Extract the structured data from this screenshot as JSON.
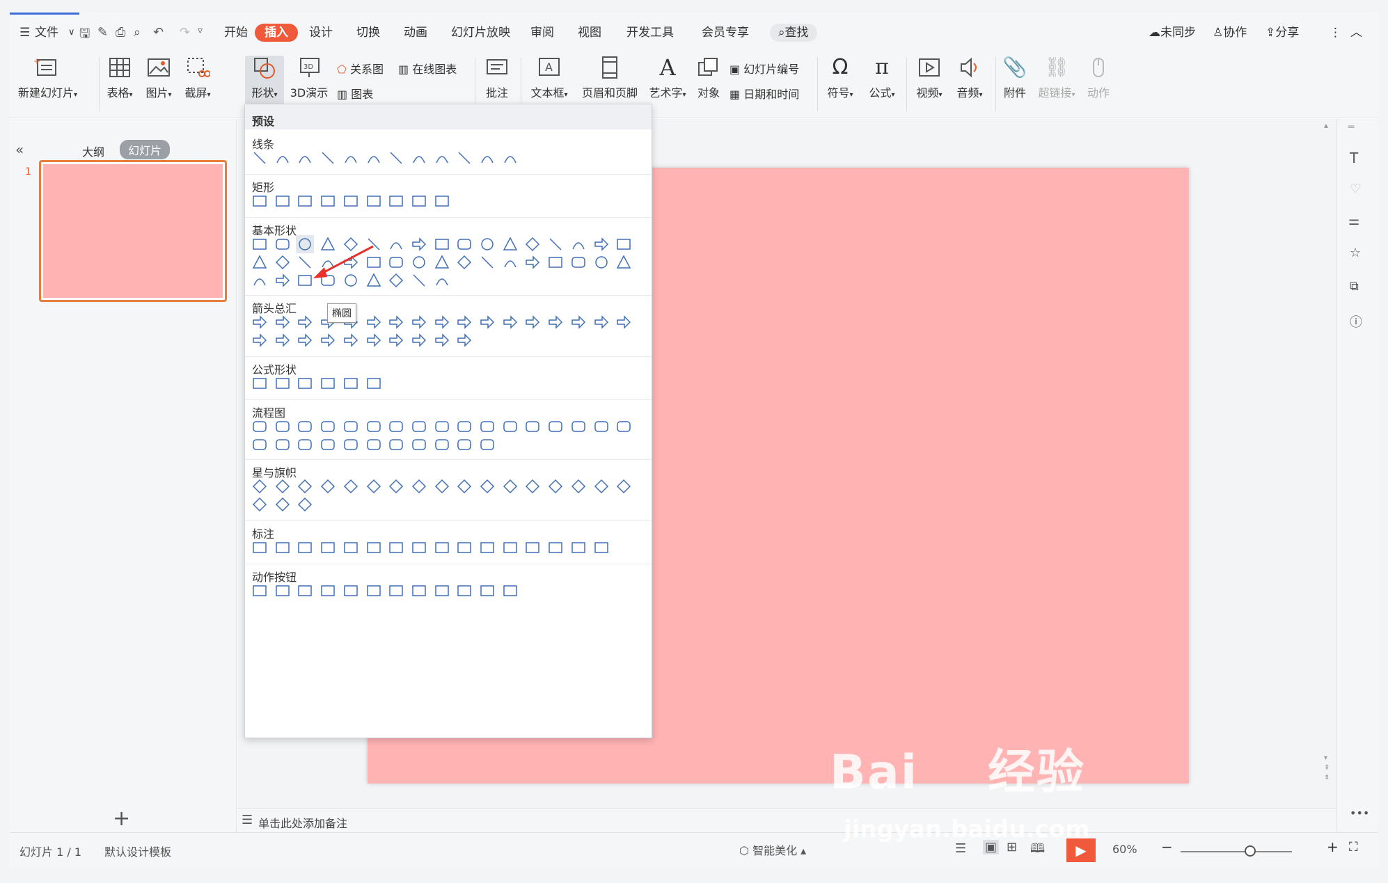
{
  "menu": {
    "file": "文件",
    "tabs": [
      "开始",
      "插入",
      "设计",
      "切换",
      "动画",
      "幻灯片放映",
      "审阅",
      "视图",
      "开发工具",
      "会员专享"
    ],
    "active_tab": "插入",
    "search": "查找",
    "sync": "未同步",
    "collab": "协作",
    "share": "分享"
  },
  "ribbon": {
    "new_slide": "新建幻灯片",
    "table": "表格",
    "picture": "图片",
    "screenshot": "截屏",
    "shape": "形状",
    "demo3d": "3D演示",
    "relation": "关系图",
    "online_chart": "在线图表",
    "chart": "图表",
    "comment": "批注",
    "textbox": "文本框",
    "header_footer": "页眉和页脚",
    "wordart": "艺术字",
    "object": "对象",
    "slide_number": "幻灯片编号",
    "datetime": "日期和时间",
    "symbol": "符号",
    "formula": "公式",
    "video": "视频",
    "audio": "音频",
    "attachment": "附件",
    "hyperlink": "超链接",
    "action": "动作"
  },
  "leftpane": {
    "outline_tab": "大纲",
    "slides_tab": "幻灯片",
    "slide_index": "1",
    "add": "+"
  },
  "colors": {
    "slide_bg": "#ffb3b3",
    "accent": "#f0593a",
    "shape_stroke": "#3f6fb5",
    "thumb_border": "#e87d42"
  },
  "dropdown": {
    "header": "预设",
    "categories": [
      "线条",
      "矩形",
      "基本形状",
      "箭头总汇",
      "公式形状",
      "流程图",
      "星与旗帜",
      "标注",
      "动作按钮"
    ],
    "tooltip": "椭圆"
  },
  "notes": {
    "placeholder": "单击此处添加备注"
  },
  "status": {
    "slide_info": "幻灯片 1 / 1",
    "template": "默认设计模板",
    "smart": "智能美化",
    "zoom": "60%"
  },
  "watermark": {
    "brand": "Bai",
    "brand2": "经验",
    "url": "jingyan.baidu.com"
  }
}
